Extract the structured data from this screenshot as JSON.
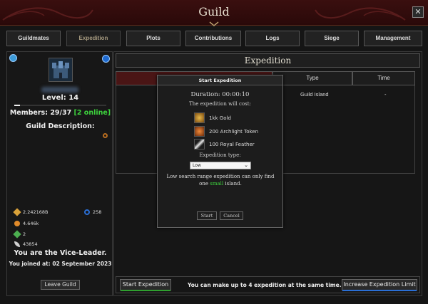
{
  "window": {
    "title": "Guild",
    "close_label": "✕"
  },
  "tabs": [
    "Guildmates",
    "Expedition",
    "Plots",
    "Contributions",
    "Logs",
    "Siege",
    "Management"
  ],
  "active_tab": "Expedition",
  "guild": {
    "level": "Level: 14",
    "members_prefix": "Members: 29/37 ",
    "members_online": "[2 online]",
    "description_label": "Guild Description:",
    "stats": [
      {
        "icon": "gold-icon",
        "value": "2.242168B"
      },
      {
        "icon": "token-icon",
        "value": "4.646k"
      },
      {
        "icon": "green-gem-icon",
        "value": "2"
      },
      {
        "icon": "feather-icon",
        "value": "43854"
      },
      {
        "icon": "blue-ring-icon",
        "value": "258"
      }
    ],
    "role": "You are the Vice-Leader.",
    "joined": "You joined at: 02 September 2023",
    "leave_button": "Leave Guild"
  },
  "expedition": {
    "header": "Expedition",
    "columns": {
      "type": "Type",
      "time": "Time"
    },
    "row": {
      "type": "Guild Island",
      "time": "-"
    },
    "start_button": "Start Expedition",
    "limit_text": "You can make up to 4 expedition at the same time.",
    "limit_button": "Increase Expedition Limit"
  },
  "modal": {
    "title": "Start Expedition",
    "duration": "Duration: 00:00:10",
    "cost_label": "The expedition will cost:",
    "costs": [
      {
        "icon": "gold-icon",
        "label": "1kk Gold"
      },
      {
        "icon": "archlight-token-icon",
        "label": "200 Archlight Token"
      },
      {
        "icon": "royal-feather-icon",
        "label": "100 Royal Feather"
      }
    ],
    "type_label": "Expedition type:",
    "type_value": "Low",
    "desc_before": "Low search range expedition can only find one ",
    "desc_highlight": "small",
    "desc_after": " island.",
    "start_button": "Start",
    "cancel_button": "Cancel"
  },
  "colors": {
    "online": "#3dd23d",
    "start_underline": "#2fa02f",
    "limit_underline": "#2a6fd6",
    "title_bar": "#3a0f0f"
  }
}
